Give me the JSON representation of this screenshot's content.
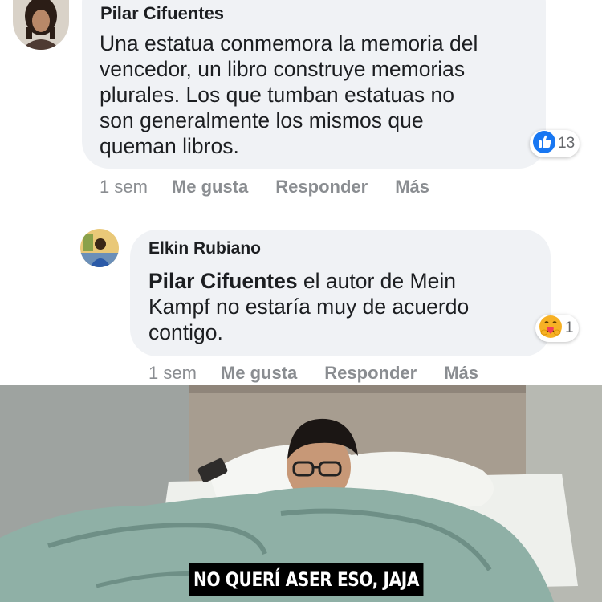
{
  "comments": [
    {
      "author": "Pilar Cifuentes",
      "lines": [
        "Una estatua conmemora la memoria del",
        "vencedor, un libro construye memorias",
        "plurales. Los que tumban estatuas no",
        "son generalmente los mismos que",
        "queman libros."
      ],
      "reaction": {
        "icon": "like-icon",
        "count": "13",
        "color": "#1877f2"
      },
      "actions": {
        "time": "1 sem",
        "like": "Me gusta",
        "reply": "Responder",
        "more": "Más"
      }
    },
    {
      "author": "Elkin Rubiano",
      "mention": "Pilar Cifuentes",
      "line1_rest": " el autor de Mein",
      "lines": [
        "Kampf no estaría muy de acuerdo",
        "contigo."
      ],
      "reaction": {
        "icon": "care-icon",
        "count": "1",
        "color": "#f7b125"
      },
      "actions": {
        "time": "1 sem",
        "like": "Me gusta",
        "reply": "Responder",
        "more": "Más"
      }
    }
  ],
  "meme": {
    "caption": "NO QUERÍ ASER ESO, JAJA"
  }
}
